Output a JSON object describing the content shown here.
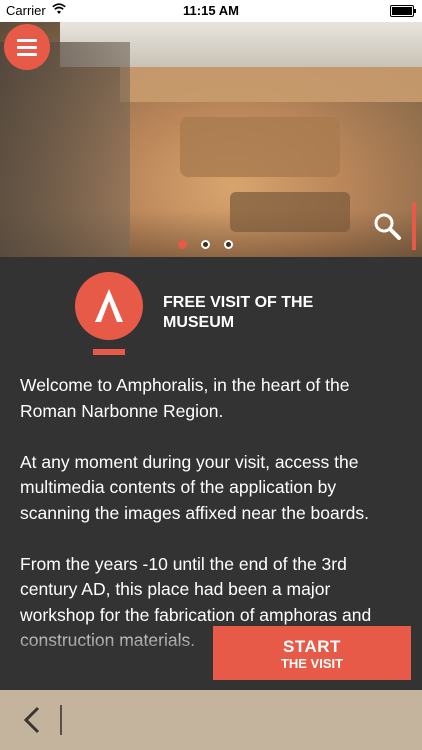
{
  "status_bar": {
    "carrier": "Carrier",
    "time": "11:15 AM"
  },
  "hero": {
    "image": "archaeological-excavation-site-under-roof",
    "carousel": {
      "count": 3,
      "active_index": 0
    }
  },
  "header": {
    "title_line1": "FREE VISIT OF THE",
    "title_line2": "MUSEUM"
  },
  "content": {
    "paragraphs": [
      "Welcome to Amphoralis, in the heart of the Roman Narbonne Region.",
      "At any moment during your visit, access the multimedia contents of the application by scanning the images affixed near the boards.",
      "From the years -10 until the end of the 3rd century AD, this place had been a major workshop for the fabrication of amphoras and construction materials."
    ]
  },
  "start_button": {
    "line1": "START",
    "line2": "THE VISIT"
  },
  "colors": {
    "accent": "#e85a48",
    "background": "#333333",
    "bottom_bar": "#c5b49d"
  }
}
